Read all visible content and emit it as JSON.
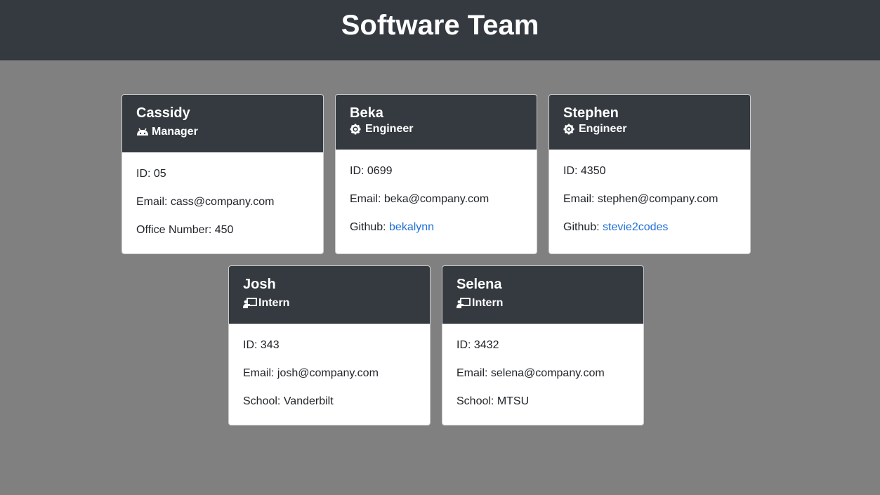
{
  "header": {
    "title": "Software Team"
  },
  "cards": [
    {
      "name": "Cassidy",
      "role": "Manager",
      "role_icon": "android-icon",
      "id_line": "ID: 05",
      "email_label": "Email: ",
      "email": "cass@company.com",
      "extra_label": "Office Number: ",
      "extra_value": "450"
    },
    {
      "name": "Beka",
      "role": "Engineer",
      "role_icon": "gear-icon",
      "id_line": "ID: 0699",
      "email_label": "Email: ",
      "email": "beka@company.com",
      "extra_label": "Github: ",
      "extra_value": "bekalynn"
    },
    {
      "name": "Stephen",
      "role": "Engineer",
      "role_icon": "gear-icon",
      "id_line": "ID: 4350",
      "email_label": "Email: ",
      "email": "stephen@company.com",
      "extra_label": "Github: ",
      "extra_value": "stevie2codes"
    },
    {
      "name": "Josh",
      "role": "Intern",
      "role_icon": "chalkboard-teacher-icon",
      "id_line": "ID: 343",
      "email_label": "Email: ",
      "email": "josh@company.com",
      "extra_label": "School: ",
      "extra_value": "Vanderbilt"
    },
    {
      "name": "Selena",
      "role": "Intern",
      "role_icon": "chalkboard-teacher-icon",
      "id_line": "ID: 3432",
      "email_label": "Email: ",
      "email": "selena@company.com",
      "extra_label": "School: ",
      "extra_value": "MTSU"
    }
  ]
}
